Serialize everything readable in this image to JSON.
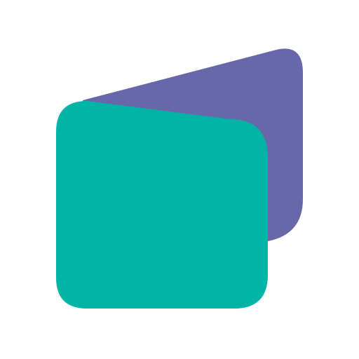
{
  "logo": {
    "icon": "stacked-cards-logo-icon",
    "colors": {
      "back_card": "#6767A9",
      "front_card": "#00B5A6",
      "background": "#FFFFFF"
    }
  }
}
